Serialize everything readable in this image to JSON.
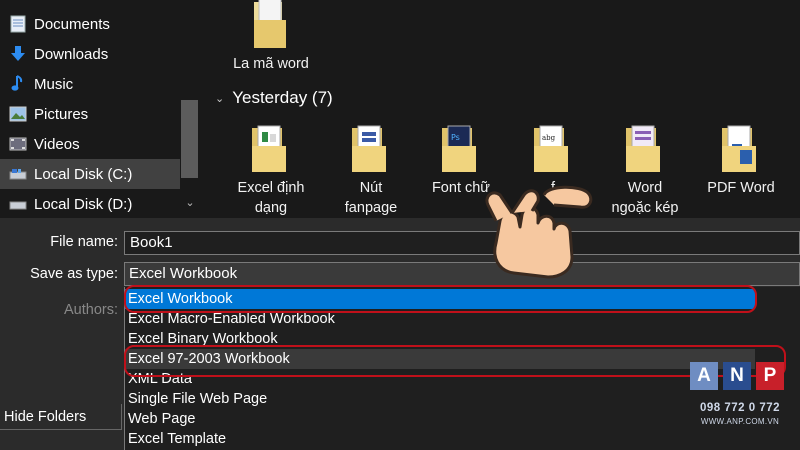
{
  "nav": {
    "items": [
      {
        "label": "Documents",
        "icon": "documents-icon"
      },
      {
        "label": "Downloads",
        "icon": "download-arrow-icon"
      },
      {
        "label": "Music",
        "icon": "music-note-icon"
      },
      {
        "label": "Pictures",
        "icon": "pictures-icon"
      },
      {
        "label": "Videos",
        "icon": "videos-icon"
      },
      {
        "label": "Local Disk (C:)",
        "icon": "drive-icon"
      },
      {
        "label": "Local Disk (D:)",
        "icon": "drive-icon"
      }
    ]
  },
  "files": {
    "top_item": {
      "label": "La mã word"
    },
    "group": {
      "label": "Yesterday (7)"
    },
    "items": [
      {
        "line1": "Excel định",
        "line2": "dạng"
      },
      {
        "line1": "Nút",
        "line2": "fanpage"
      },
      {
        "line1": "Font chữ",
        "line2": ""
      },
      {
        "line1": "f",
        "line2": ""
      },
      {
        "line1": "Word",
        "line2": "ngoặc kép"
      },
      {
        "line1": "PDF Word",
        "line2": ""
      }
    ]
  },
  "form": {
    "file_name_label": "File name:",
    "file_name_value": "Book1",
    "save_type_label": "Save as type:",
    "save_type_value": "Excel Workbook",
    "authors_label": "Authors:",
    "hide_folders_label": "Hide Folders",
    "options": [
      "Excel Workbook",
      "Excel Macro-Enabled Workbook",
      "Excel Binary Workbook",
      "Excel 97-2003 Workbook",
      "XML Data",
      "Single File Web Page",
      "Web Page",
      "Excel Template"
    ]
  },
  "logo": {
    "letters": [
      "A",
      "N",
      "P"
    ],
    "phone": "098 772 0 772",
    "website": "WWW.ANP.COM.VN"
  },
  "colors": {
    "selection": "#0078d7",
    "annotation_red": "#c0101a",
    "logo_a": "#6f8dc2",
    "logo_n": "#2a4d8f",
    "logo_p": "#c8202a"
  }
}
